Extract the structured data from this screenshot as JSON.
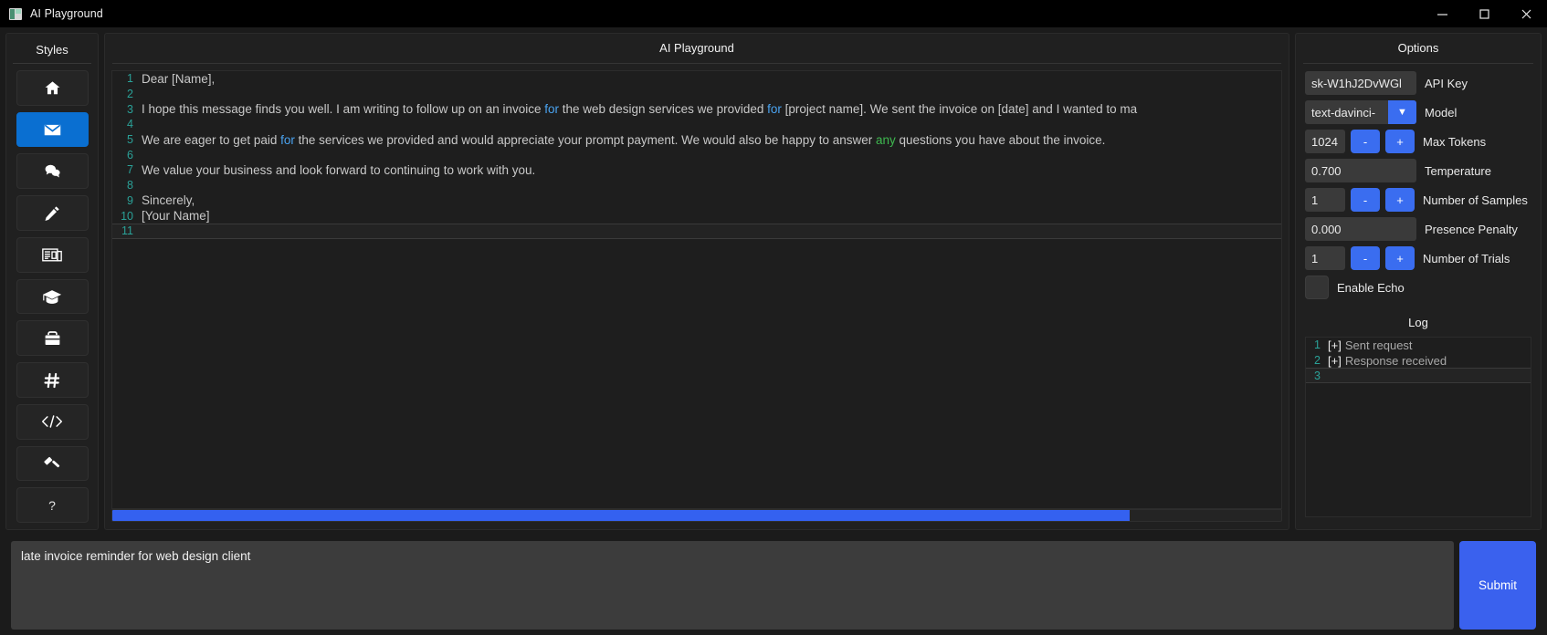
{
  "window": {
    "title": "AI Playground",
    "icon": "app-icon",
    "controls": {
      "minimize": "minimize-icon",
      "maximize": "maximize-icon",
      "close": "close-icon"
    }
  },
  "sidebar": {
    "title": "Styles",
    "items": [
      {
        "name": "home",
        "icon": "home-icon",
        "active": false
      },
      {
        "name": "email",
        "icon": "envelope-icon",
        "active": true
      },
      {
        "name": "chat",
        "icon": "chat-bubbles-icon",
        "active": false
      },
      {
        "name": "write",
        "icon": "pencil-icon",
        "active": false
      },
      {
        "name": "news",
        "icon": "newspaper-icon",
        "active": false
      },
      {
        "name": "academic",
        "icon": "graduation-cap-icon",
        "active": false
      },
      {
        "name": "business",
        "icon": "briefcase-icon",
        "active": false
      },
      {
        "name": "social",
        "icon": "hashtag-icon",
        "active": false
      },
      {
        "name": "code",
        "icon": "code-icon",
        "active": false
      },
      {
        "name": "legal",
        "icon": "gavel-icon",
        "active": false
      },
      {
        "name": "help",
        "icon": "question-mark",
        "active": false,
        "label": "?"
      }
    ]
  },
  "editor": {
    "title": "AI Playground",
    "lines": [
      {
        "n": "1",
        "segments": [
          {
            "t": "Dear [Name],",
            "c": "plain"
          }
        ]
      },
      {
        "n": "2",
        "segments": []
      },
      {
        "n": "3",
        "segments": [
          {
            "t": "I hope this message finds you well. I am writing to follow up on an invoice ",
            "c": "plain"
          },
          {
            "t": "for",
            "c": "kw"
          },
          {
            "t": " the web design services we provided ",
            "c": "plain"
          },
          {
            "t": "for",
            "c": "kw"
          },
          {
            "t": " [project name]. We sent the invoice on [date] and I wanted to ma",
            "c": "plain"
          }
        ]
      },
      {
        "n": "4",
        "segments": []
      },
      {
        "n": "5",
        "segments": [
          {
            "t": "We are eager to get paid ",
            "c": "plain"
          },
          {
            "t": "for",
            "c": "kw"
          },
          {
            "t": " the services we provided and would appreciate your prompt payment. We would also be happy to answer ",
            "c": "plain"
          },
          {
            "t": "any",
            "c": "kw2"
          },
          {
            "t": " questions you have about the invoice.",
            "c": "plain"
          }
        ]
      },
      {
        "n": "6",
        "segments": []
      },
      {
        "n": "7",
        "segments": [
          {
            "t": "We value your business and look forward to continuing to work with you.",
            "c": "plain"
          }
        ]
      },
      {
        "n": "8",
        "segments": []
      },
      {
        "n": "9",
        "segments": [
          {
            "t": "Sincerely,",
            "c": "plain"
          }
        ]
      },
      {
        "n": "10",
        "segments": [
          {
            "t": "[Your Name]",
            "c": "plain"
          }
        ]
      },
      {
        "n": "11",
        "segments": [],
        "caret": true
      }
    ],
    "progress_percent": 87
  },
  "options": {
    "title": "Options",
    "api_key": {
      "label": "API Key",
      "value": "sk-W1hJ2DvWGl"
    },
    "model": {
      "label": "Model",
      "value": "text-davinci-",
      "arrow": "chevron-down-icon"
    },
    "max_tokens": {
      "label": "Max Tokens",
      "value": "1024",
      "minus": "-",
      "plus": "+"
    },
    "temperature": {
      "label": "Temperature",
      "value": "0.700"
    },
    "number_of_samples": {
      "label": "Number of Samples",
      "value": "1",
      "minus": "-",
      "plus": "+"
    },
    "presence_penalty": {
      "label": "Presence Penalty",
      "value": "0.000"
    },
    "number_of_trials": {
      "label": "Number of Trials",
      "value": "1",
      "minus": "-",
      "plus": "+"
    },
    "enable_echo": {
      "label": "Enable Echo",
      "checked": false
    }
  },
  "log": {
    "title": "Log",
    "lines": [
      {
        "n": "1",
        "prefix": "[+]",
        "text": "Sent request",
        "active": false
      },
      {
        "n": "2",
        "prefix": "[+]",
        "text": "Response received",
        "active": false
      },
      {
        "n": "3",
        "prefix": "",
        "text": "",
        "active": true
      }
    ]
  },
  "bottom": {
    "prompt_value": "late invoice reminder for web design client",
    "prompt_placeholder": "",
    "submit_label": "Submit"
  },
  "colors": {
    "accent_blue": "#3a61ee",
    "active_item": "#0a6fd1",
    "line_number": "#2aa198",
    "keyword": "#4aa3f0",
    "keyword_alt": "#3fb950"
  }
}
